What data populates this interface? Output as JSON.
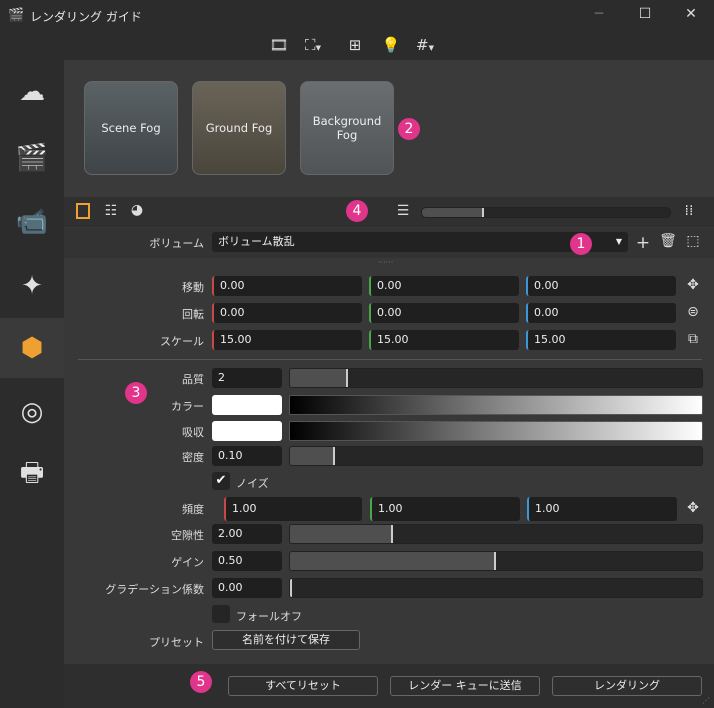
{
  "window": {
    "title": "レンダリング ガイド",
    "minimize": "─",
    "maximize": "☐",
    "close": "✕"
  },
  "toolbar_icons": [
    "film-frame-icon",
    "safe-frame-icon",
    "viewport-layout-icon",
    "light-view-icon",
    "grid-icon"
  ],
  "sidebar": {
    "items": [
      "fog-presets",
      "scene-settings",
      "camera-settings",
      "lights",
      "volume",
      "lens-effects",
      "print"
    ],
    "active": 4
  },
  "presets": [
    {
      "label": "Scene Fog"
    },
    {
      "label": "Ground Fog"
    },
    {
      "label": "Background Fog"
    }
  ],
  "badges": {
    "b1": "1",
    "b2": "2",
    "b3": "3",
    "b4": "4",
    "b5": "5"
  },
  "zoom_slider": 0.2,
  "volume": {
    "label": "ボリューム",
    "value": "ボリューム散乱"
  },
  "transform": {
    "move": {
      "label": "移動",
      "x": "0.00",
      "y": "0.00",
      "z": "0.00"
    },
    "rotate": {
      "label": "回転",
      "x": "0.00",
      "y": "0.00",
      "z": "0.00"
    },
    "scale": {
      "label": "スケール",
      "x": "15.00",
      "y": "15.00",
      "z": "15.00"
    }
  },
  "props": {
    "quality": {
      "label": "品質",
      "value": "2",
      "fraction": 0.14
    },
    "color": {
      "label": "カラー",
      "color": "#ffffff"
    },
    "absorb": {
      "label": "吸収",
      "color": "#ffffff"
    },
    "density": {
      "label": "密度",
      "value": "0.10",
      "fraction": 0.11
    },
    "noise": {
      "label": "ノイズ",
      "checked": true
    },
    "frequency": {
      "label": "頻度",
      "x": "1.00",
      "y": "1.00",
      "z": "1.00"
    },
    "porosity": {
      "label": "空隙性",
      "value": "2.00",
      "fraction": 0.25
    },
    "gain": {
      "label": "ゲイン",
      "value": "0.50",
      "fraction": 0.5
    },
    "gradient": {
      "label": "グラデーション係数",
      "value": "0.00",
      "fraction": 0.0
    },
    "falloff": {
      "label": "フォールオフ",
      "checked": false
    },
    "preset": {
      "label": "プリセット",
      "save": "名前を付けて保存"
    }
  },
  "footer": {
    "reset": "すべてリセット",
    "queue": "レンダー キューに送信",
    "render": "レンダリング"
  }
}
